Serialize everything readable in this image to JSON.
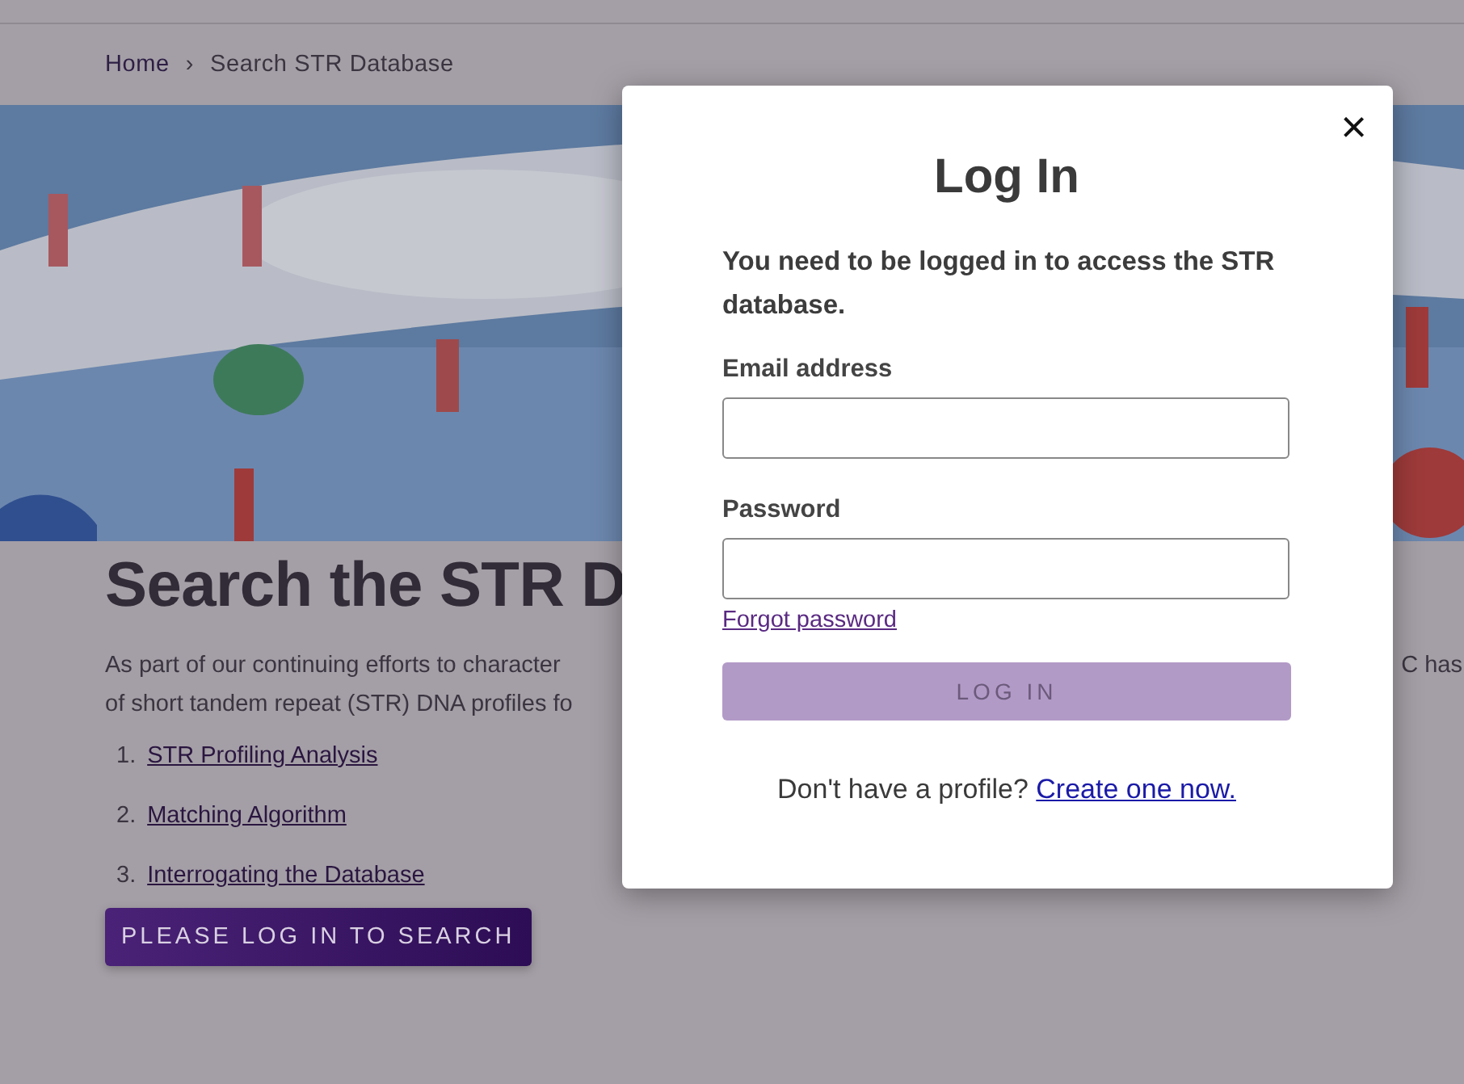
{
  "breadcrumb": {
    "separator": "›",
    "items": [
      {
        "label": "Home",
        "kind": "link"
      },
      {
        "label": "Search STR Database",
        "kind": "current"
      }
    ]
  },
  "heading": "Search the STR D",
  "intro": {
    "lines": [
      {
        "left": "As part of our continuing efforts to character",
        "right": "C has"
      },
      {
        "left": "of short tandem repeat (STR) DNA profiles fo"
      }
    ]
  },
  "links": [
    {
      "number": "1.",
      "label": "STR Profiling Analysis"
    },
    {
      "number": "2.",
      "label": "Matching Algorithm"
    },
    {
      "number": "3.",
      "label": "Interrogating the Database"
    }
  ],
  "search_button": "PLEASE LOG IN TO SEARCH",
  "modal": {
    "close": "×",
    "title": "Log In",
    "message": "You need to be logged in to access the STR database.",
    "fields": [
      {
        "label": "Email address"
      },
      {
        "label": "Password"
      }
    ],
    "forgot_link": "Forgot password",
    "submit": {
      "label": "LOG IN",
      "disabled": true
    },
    "signup": {
      "text": "Don't have a profile?",
      "link": "Create one now."
    }
  }
}
